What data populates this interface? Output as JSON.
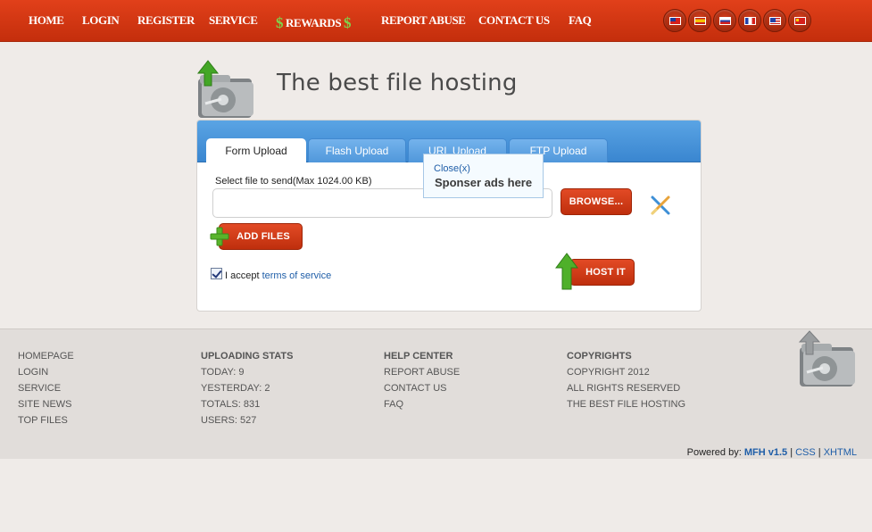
{
  "nav": {
    "home": "HOME",
    "login": "LOGIN",
    "register": "REGISTER",
    "service": "SERVICE",
    "rewards": "REWARDS",
    "dollar": "$",
    "report_abuse": "REPORT ABUSE",
    "contact_us": "CONTACT US",
    "faq": "FAQ"
  },
  "languages": [
    "taiwan-flag",
    "spain-flag",
    "russia-flag",
    "france-flag",
    "usa-flag",
    "china-flag"
  ],
  "header": {
    "title": "The best file hosting"
  },
  "tabs": [
    "Form Upload",
    "Flash Upload",
    "URL Upload",
    "FTP Upload"
  ],
  "upload": {
    "select_label": "Select file to send(Max 1024.00 KB)",
    "file_value": "",
    "browse": "BROWSE...",
    "add_files": "ADD FILES",
    "host_it": "HOST IT",
    "accept_prefix": "I accept",
    "terms_link": "terms of service",
    "accept_checked": true
  },
  "popup": {
    "close": "Close(x)",
    "text": "Sponser ads here"
  },
  "footer": {
    "col1": [
      "HOMEPAGE",
      "LOGIN",
      "SERVICE",
      "SITE NEWS",
      "TOP FILES"
    ],
    "stats": {
      "heading": "UPLOADING STATS",
      "today": "TODAY: 9",
      "yesterday": "YESTERDAY: 2",
      "totals": "TOTALS: 831",
      "users": "USERS: 527"
    },
    "help": {
      "heading": "HELP CENTER",
      "items": [
        "REPORT ABUSE",
        "CONTACT US",
        "FAQ"
      ]
    },
    "copyrights": {
      "heading": "COPYRIGHTS",
      "lines": [
        "COPYRIGHT 2012",
        "ALL RIGHTS RESERVED",
        "THE BEST FILE HOSTING"
      ]
    },
    "powered_by": "Powered by:",
    "mfh": "MFH v1.5",
    "sep": "|",
    "css": "CSS",
    "xhtml": "XHTML"
  },
  "colors": {
    "nav_bg": "#d2360f",
    "panel_header": "#4894da",
    "button_red": "#d03a16",
    "link_blue": "#1f5ea8",
    "page_bg": "#efebe8"
  }
}
